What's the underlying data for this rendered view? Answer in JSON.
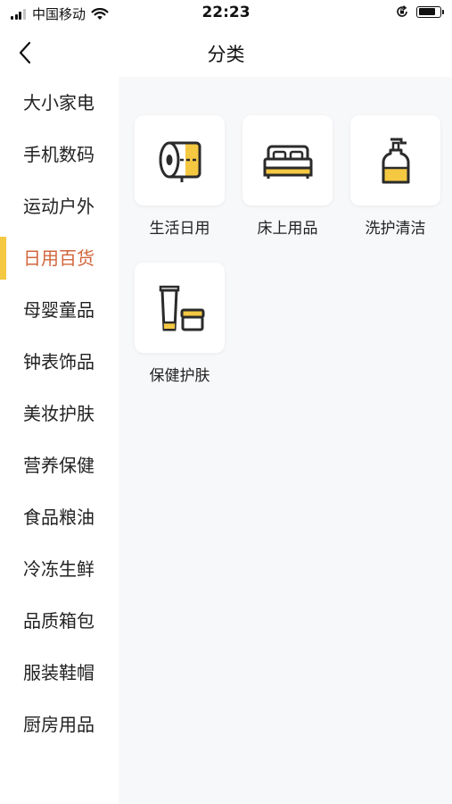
{
  "status": {
    "carrier": "中国移动",
    "time": "22:23",
    "icons": [
      "signal-icon",
      "wifi-icon",
      "rotation-lock-icon",
      "battery-icon"
    ]
  },
  "nav": {
    "title": "分类",
    "back_icon": "chevron-left-icon"
  },
  "sidebar": {
    "active_index": 3,
    "active_color": "#d2663c",
    "indicator_color": "#f5c842",
    "items": [
      {
        "label": "大小家电"
      },
      {
        "label": "手机数码"
      },
      {
        "label": "运动户外"
      },
      {
        "label": "日用百货"
      },
      {
        "label": "母婴童品"
      },
      {
        "label": "钟表饰品"
      },
      {
        "label": "美妆护肤"
      },
      {
        "label": "营养保健"
      },
      {
        "label": "食品粮油"
      },
      {
        "label": "冷冻生鲜"
      },
      {
        "label": "品质箱包"
      },
      {
        "label": "服装鞋帽"
      },
      {
        "label": "厨房用品"
      }
    ]
  },
  "subcategories": [
    {
      "label": "生活日用",
      "icon": "toilet-paper-roll-icon"
    },
    {
      "label": "床上用品",
      "icon": "bed-icon"
    },
    {
      "label": "洗护清洁",
      "icon": "soap-pump-bottle-icon"
    },
    {
      "label": "保健护肤",
      "icon": "skincare-tube-jar-icon"
    }
  ],
  "icon_colors": {
    "stroke": "#2b2b2b",
    "accent": "#f5c842"
  }
}
